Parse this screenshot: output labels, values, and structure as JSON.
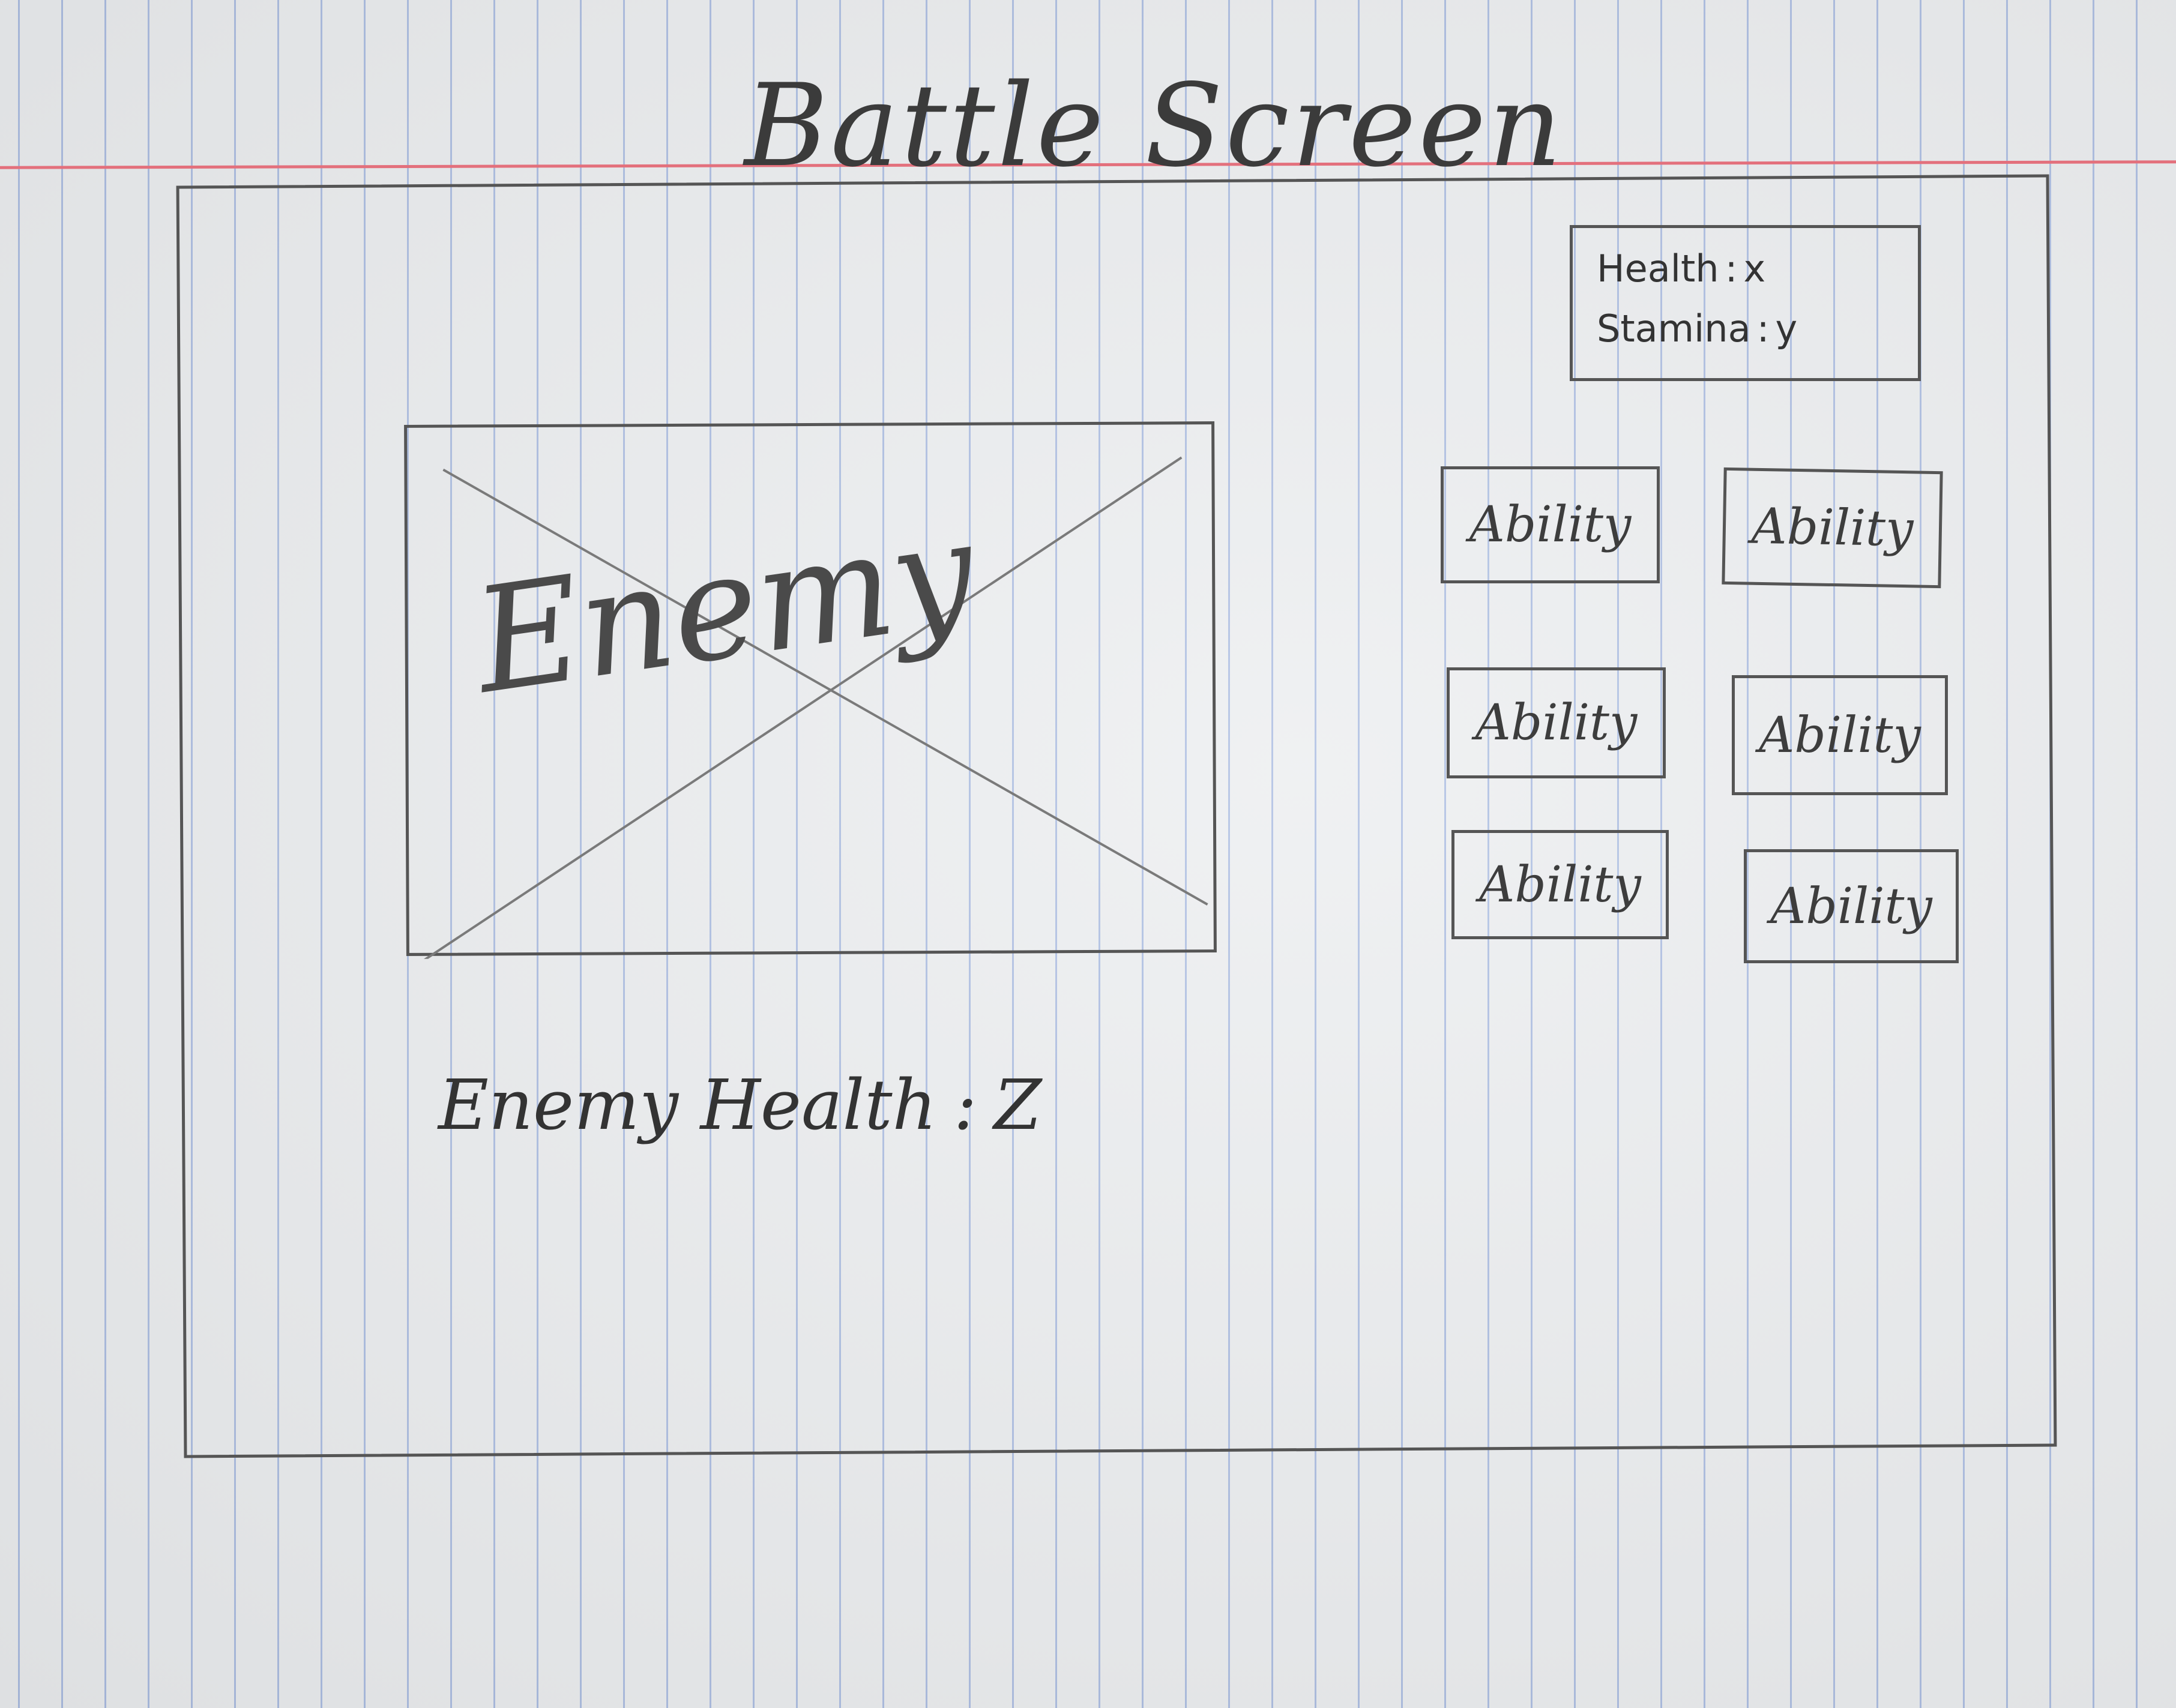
{
  "screen": {
    "title": "Battle Screen"
  },
  "player_stats": {
    "health_label": "Health",
    "health_value": "x",
    "stamina_label": "Stamina",
    "stamina_value": "y",
    "separator": ":"
  },
  "enemy": {
    "image_label": "Enemy",
    "health_label": "Enemy Health",
    "health_value": "Z",
    "separator": ":"
  },
  "abilities": [
    {
      "label": "Ability"
    },
    {
      "label": "Ability"
    },
    {
      "label": "Ability"
    },
    {
      "label": "Ability"
    },
    {
      "label": "Ability"
    },
    {
      "label": "Ability"
    }
  ],
  "colors": {
    "paper": "#eceef0",
    "rule_line": "#7896d7",
    "margin_line": "#e3707c",
    "pencil": "#555555"
  }
}
